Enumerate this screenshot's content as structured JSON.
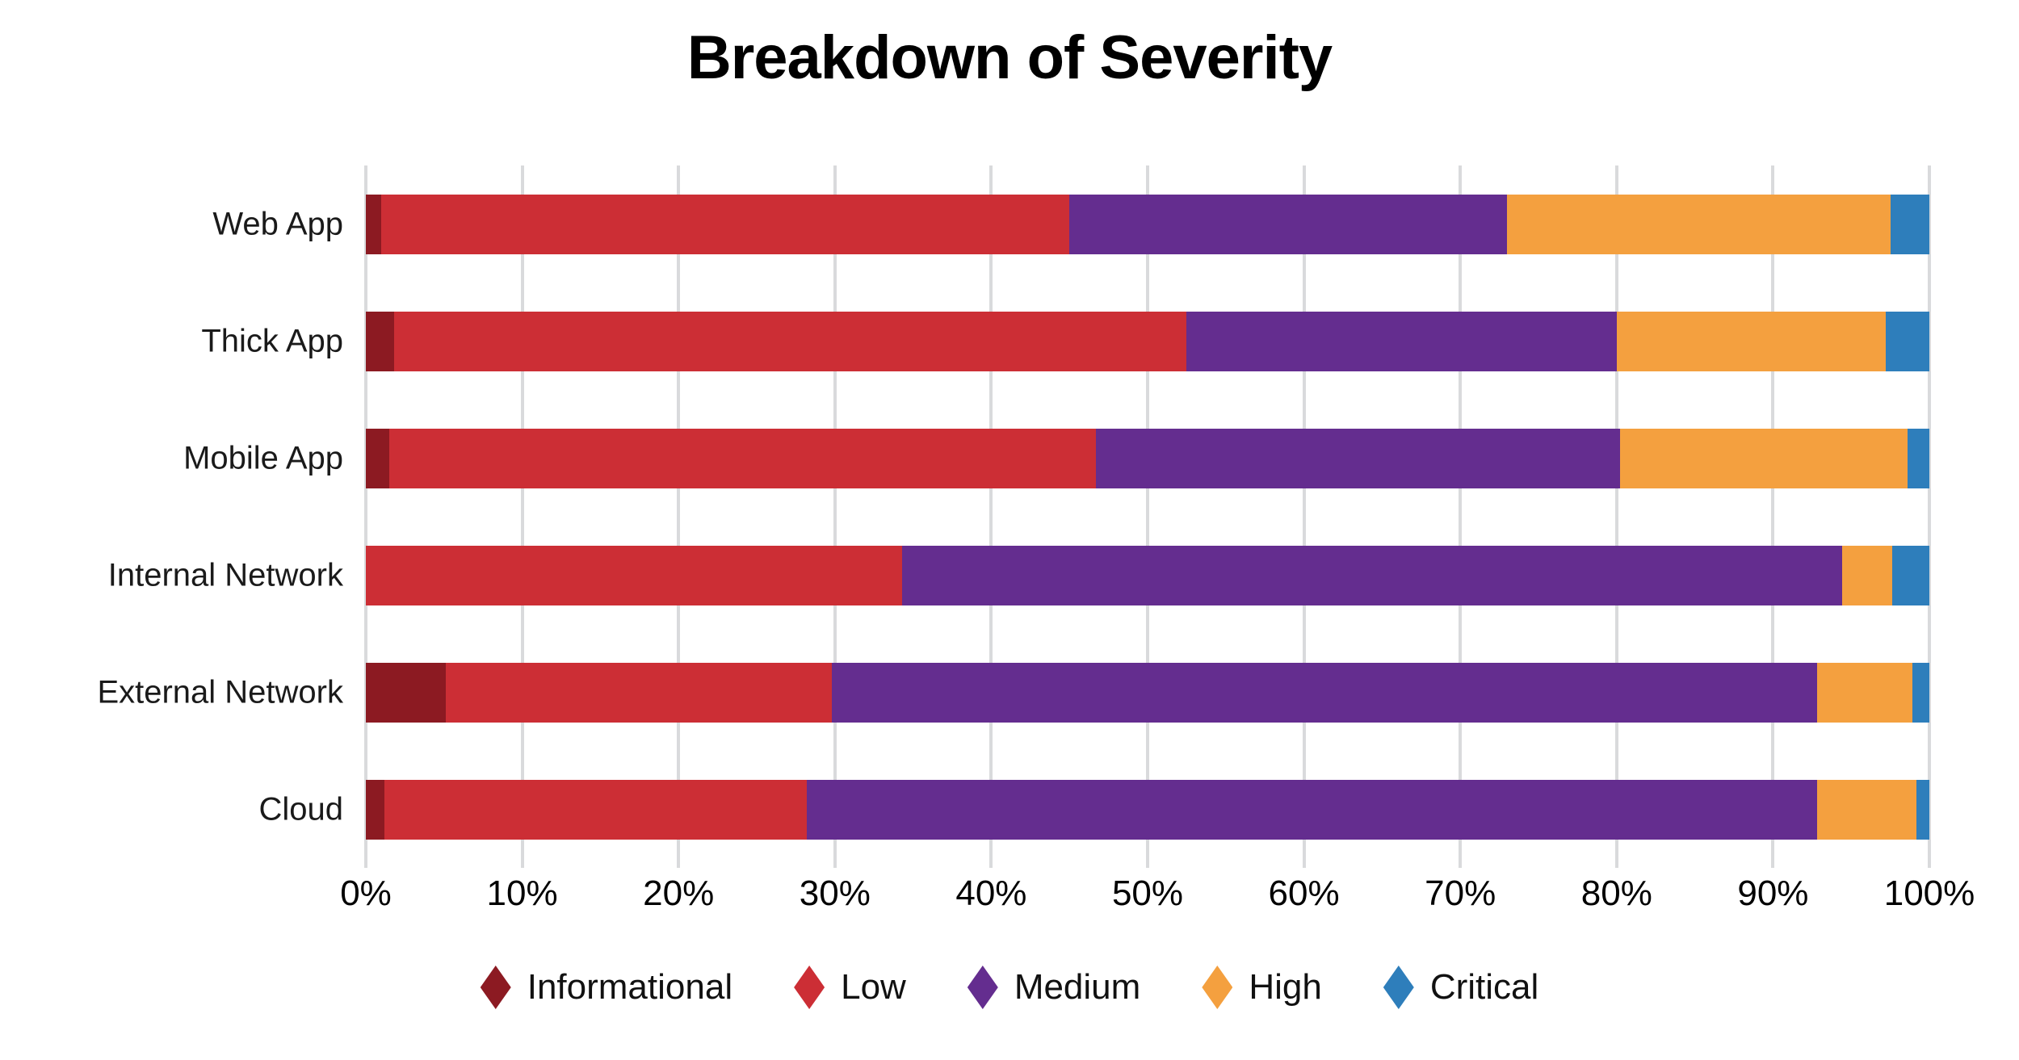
{
  "chart_data": {
    "type": "bar",
    "orientation": "horizontal",
    "stacked": true,
    "normalized": "percent",
    "title": "Breakdown of Severity",
    "xlabel": "",
    "ylabel": "",
    "xlim": [
      0,
      100
    ],
    "grid": true,
    "legend_position": "bottom",
    "categories": [
      "Web App",
      "Thick App",
      "Mobile App",
      "Internal Network",
      "External Network",
      "Cloud"
    ],
    "series": [
      {
        "name": "Informational",
        "color": "#8c1a22",
        "values": [
          1.0,
          1.8,
          1.5,
          0.0,
          5.1,
          1.2
        ]
      },
      {
        "name": "Low",
        "color": "#cc2e35",
        "values": [
          44.0,
          50.7,
          45.2,
          34.3,
          24.7,
          27.0
        ]
      },
      {
        "name": "Medium",
        "color": "#642d8f",
        "values": [
          28.0,
          27.5,
          33.5,
          60.1,
          63.0,
          64.6
        ]
      },
      {
        "name": "High",
        "color": "#f4a03f",
        "values": [
          24.5,
          17.2,
          18.4,
          3.2,
          6.1,
          6.4
        ]
      },
      {
        "name": "Critical",
        "color": "#2e7ebb",
        "values": [
          2.5,
          2.8,
          1.4,
          2.4,
          1.1,
          0.8
        ]
      }
    ],
    "x_ticks": [
      "0%",
      "10%",
      "20%",
      "30%",
      "40%",
      "50%",
      "60%",
      "70%",
      "80%",
      "90%",
      "100%"
    ],
    "x_tick_values": [
      0,
      10,
      20,
      30,
      40,
      50,
      60,
      70,
      80,
      90,
      100
    ],
    "legend_entries": [
      {
        "label": "Informational",
        "color": "#8c1a22",
        "marker": "diamond"
      },
      {
        "label": "Low",
        "color": "#cc2e35",
        "marker": "diamond"
      },
      {
        "label": "Medium",
        "color": "#642d8f",
        "marker": "diamond"
      },
      {
        "label": "High",
        "color": "#f4a03f",
        "marker": "diamond"
      },
      {
        "label": "Critical",
        "color": "#2e7ebb",
        "marker": "diamond"
      }
    ],
    "colors": {
      "informational": "#8c1a22",
      "low": "#cc2e35",
      "medium": "#642d8f",
      "high": "#f4a03f",
      "critical": "#2e7ebb",
      "gridline": "#d9dadc",
      "background": "#ffffff",
      "text": "#111111"
    }
  }
}
